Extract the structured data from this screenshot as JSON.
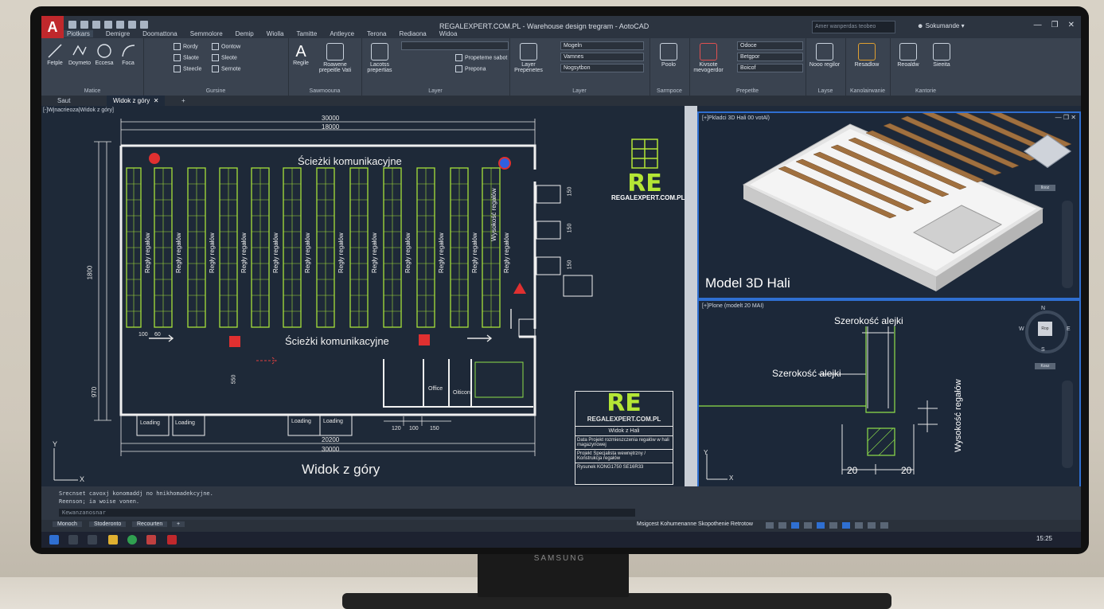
{
  "app": {
    "title": "REGALEXPERT.COM.PL - Warehouse design tregram - AotoCAD",
    "search_placeholder": "Amer wanperdas teobeo",
    "user": "Sokumande",
    "menus": [
      "Piotkars",
      "Demigre",
      "Doomattona",
      "Semmolore",
      "Demip",
      "Wiolla",
      "Tamitte",
      "Antleyce",
      "Terona",
      "Rediaona",
      "Widoa"
    ],
    "active_menu": 0
  },
  "ribbon": {
    "groups": [
      {
        "title": "Matice",
        "buttons": [
          "Fetple",
          "Doymeto",
          "Eccesa",
          "Foca"
        ]
      },
      {
        "title": "Gursine",
        "small": [
          "Rordy",
          "Slaote",
          "Steecle",
          "Oontow",
          "Sleote",
          "Sernote"
        ]
      },
      {
        "title": "Sawmoouna",
        "buttons": [
          "Regile",
          "Roawene prepeitle Vati"
        ]
      },
      {
        "title": "Layer",
        "buttons": [
          "Lacotss prepertias"
        ],
        "small": [
          "Propeteme sabot",
          "Prepona"
        ]
      },
      {
        "title": "Layer",
        "buttons": [
          "Layer Prepenetes"
        ],
        "dropdowns": [
          "Mogeln",
          "Vamnes",
          "Nogsytbon"
        ]
      },
      {
        "title": "Sarmpoce",
        "buttons": [
          "Poolo"
        ]
      },
      {
        "title": "Prepetlte",
        "buttons": [
          "Kivsote mevogerdor"
        ],
        "dropdowns": [
          "Odoce",
          "Betgpor",
          "Boicof"
        ]
      },
      {
        "title": "Layse",
        "buttons": [
          "Nooo regilor"
        ]
      },
      {
        "title": "Kanolairwanie",
        "buttons": [
          "Resadlow"
        ]
      },
      {
        "title": "Kantorie",
        "buttons": [
          "Reoaldw",
          "Sieeita"
        ]
      }
    ]
  },
  "tabs": [
    "Saut",
    "Widok z góry"
  ],
  "viewport_label": "[-]Wjnacrieoza|Widok z góry]",
  "plan": {
    "dim_top_outer": "30000",
    "dim_top_inner": "18000",
    "dim_bottom_inner": "20200",
    "dim_bottom_outer": "30000",
    "left_dim_1": "1800",
    "left_dim_2": "970",
    "aisle_top": "Ścieżki komunikacyjne",
    "aisle_bottom": "Ścieżki komunikacyjne",
    "rack_label": "Regły regałów",
    "tall_label": "Wysokość regałów",
    "loading": [
      "Loading",
      "Loading",
      "Loading",
      "Loading"
    ],
    "office": [
      "Office",
      "Oiticon"
    ],
    "office_dims": [
      "120",
      "100",
      "150"
    ],
    "door_dims": [
      "150",
      "150",
      "150"
    ],
    "inner_dim": "550",
    "view_title": "Widok z góry",
    "axis_x": "X",
    "axis_y": "Y",
    "small_dims": [
      "100",
      "60"
    ]
  },
  "logo": {
    "mark": "RE",
    "site": "REGALEXPERT.COM.PL",
    "color": "#b4e635"
  },
  "titleblock": {
    "mark": "RE",
    "site": "REGALEXPERT.COM.PL",
    "name": "Widok z Hali",
    "rows": [
      {
        "label": "Data",
        "value": "Projekt rozmieszczenia regałów w hali magazynowej"
      },
      {
        "label": "Projekt",
        "value": "Specjalista wewnętrzny / Konstrukcja regałów"
      },
      {
        "label": "Rysunek",
        "value": "KONG1750 SE16R33"
      }
    ]
  },
  "vp3d": {
    "label": "[+]Pkladci 3D Hali 00 votAl)",
    "title": "Model 3D Hali",
    "cube_label": "Ilooz"
  },
  "vp2d": {
    "label": "[+]Plone (modelt 20 MAI)",
    "alley_top": "Szerokość alejki",
    "alley_left": "Szerokość alejki",
    "rack_height": "Wysokość regałów",
    "dim_a": "20",
    "dim_b": "20",
    "compass": {
      "n": "N",
      "e": "E",
      "s": "S",
      "w": "W",
      "center": "Rop"
    },
    "compass_label": "Kosz"
  },
  "command": {
    "history": [
      "Srecnset cavoxj konomaddj no hnikhomadekcyjne.",
      "Reenson; ia woise vonen."
    ],
    "placeholder": "Kewanzanosnar"
  },
  "status": {
    "layout_tabs": [
      "Monoch",
      "Stoderonto",
      "Recourten"
    ],
    "text": "Msigcest Kohumenanne Skopothenie Retrotow",
    "time": "15:25"
  },
  "monitor": {
    "brand": "SAMSUNG"
  }
}
